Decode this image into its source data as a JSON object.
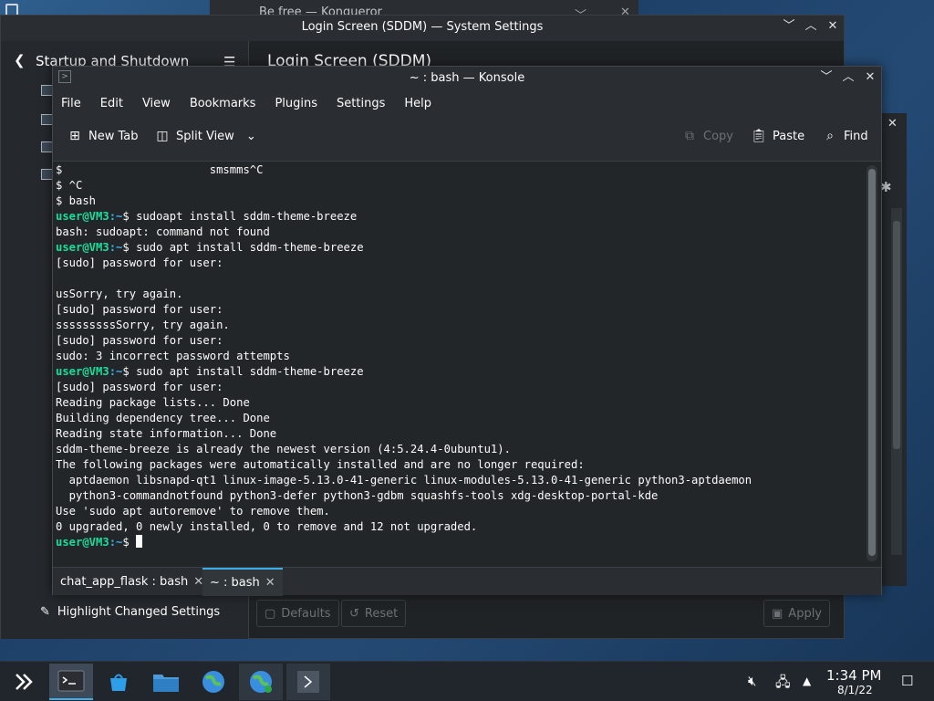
{
  "background_windows": {
    "konqueror_title_left": "Be free",
    "konqueror_title": "Konqueror"
  },
  "system_settings": {
    "title": "Login Screen (SDDM) — System Settings",
    "sidebar_title": "Startup and Shutdown",
    "page_title": "Login Screen (SDDM)",
    "highlight_label": "Highlight Changed Settings",
    "defaults_label": "Defaults",
    "reset_label": "Reset",
    "apply_label": "Apply"
  },
  "konsole": {
    "title": "~ : bash — Konsole",
    "menu": [
      "File",
      "Edit",
      "View",
      "Bookmarks",
      "Plugins",
      "Settings",
      "Help"
    ],
    "toolbar": {
      "new_tab": "New Tab",
      "split_view": "Split View",
      "copy": "Copy",
      "paste": "Paste",
      "find": "Find"
    },
    "prompt": {
      "user": "user@VM3",
      "path": ":~",
      "symbol": "$"
    },
    "lines": [
      {
        "type": "plain",
        "text": "$                      smsmms^C"
      },
      {
        "type": "plain",
        "text": "$ ^C"
      },
      {
        "type": "plain",
        "text": "$ bash"
      },
      {
        "type": "prompt",
        "text": " sudoapt install sddm-theme-breeze"
      },
      {
        "type": "plain",
        "text": "bash: sudoapt: command not found"
      },
      {
        "type": "prompt",
        "text": " sudo apt install sddm-theme-breeze"
      },
      {
        "type": "plain",
        "text": "[sudo] password for user:"
      },
      {
        "type": "plain",
        "text": ""
      },
      {
        "type": "plain",
        "text": "usSorry, try again."
      },
      {
        "type": "plain",
        "text": "[sudo] password for user:"
      },
      {
        "type": "plain",
        "text": "sssssssssSorry, try again."
      },
      {
        "type": "plain",
        "text": "[sudo] password for user:"
      },
      {
        "type": "plain",
        "text": "sudo: 3 incorrect password attempts"
      },
      {
        "type": "prompt",
        "text": " sudo apt install sddm-theme-breeze"
      },
      {
        "type": "plain",
        "text": "[sudo] password for user:"
      },
      {
        "type": "plain",
        "text": "Reading package lists... Done"
      },
      {
        "type": "plain",
        "text": "Building dependency tree... Done"
      },
      {
        "type": "plain",
        "text": "Reading state information... Done"
      },
      {
        "type": "plain",
        "text": "sddm-theme-breeze is already the newest version (4:5.24.4-0ubuntu1)."
      },
      {
        "type": "plain",
        "text": "The following packages were automatically installed and are no longer required:"
      },
      {
        "type": "plain",
        "text": "  aptdaemon libsnapd-qt1 linux-image-5.13.0-41-generic linux-modules-5.13.0-41-generic python3-aptdaemon"
      },
      {
        "type": "plain",
        "text": "  python3-commandnotfound python3-defer python3-gdbm squashfs-tools xdg-desktop-portal-kde"
      },
      {
        "type": "plain",
        "text": "Use 'sudo apt autoremove' to remove them."
      },
      {
        "type": "plain",
        "text": "0 upgraded, 0 newly installed, 0 to remove and 12 not upgraded."
      },
      {
        "type": "cursor",
        "text": " "
      }
    ],
    "tabs": [
      {
        "label": "chat_app_flask : bash",
        "active": false
      },
      {
        "label": "~ : bash",
        "active": true
      }
    ]
  },
  "taskbar": {
    "time": "1:34 PM",
    "date": "8/1/22",
    "items": [
      "application-launcher-icon",
      "konsole-icon",
      "discover-icon",
      "file-manager-icon",
      "browser-icon",
      "browser-icon",
      "terminal-icon"
    ]
  },
  "colors": {
    "prompt_user": "#1cdc9a",
    "prompt_path": "#3daee9",
    "accent": "#3daee9"
  }
}
